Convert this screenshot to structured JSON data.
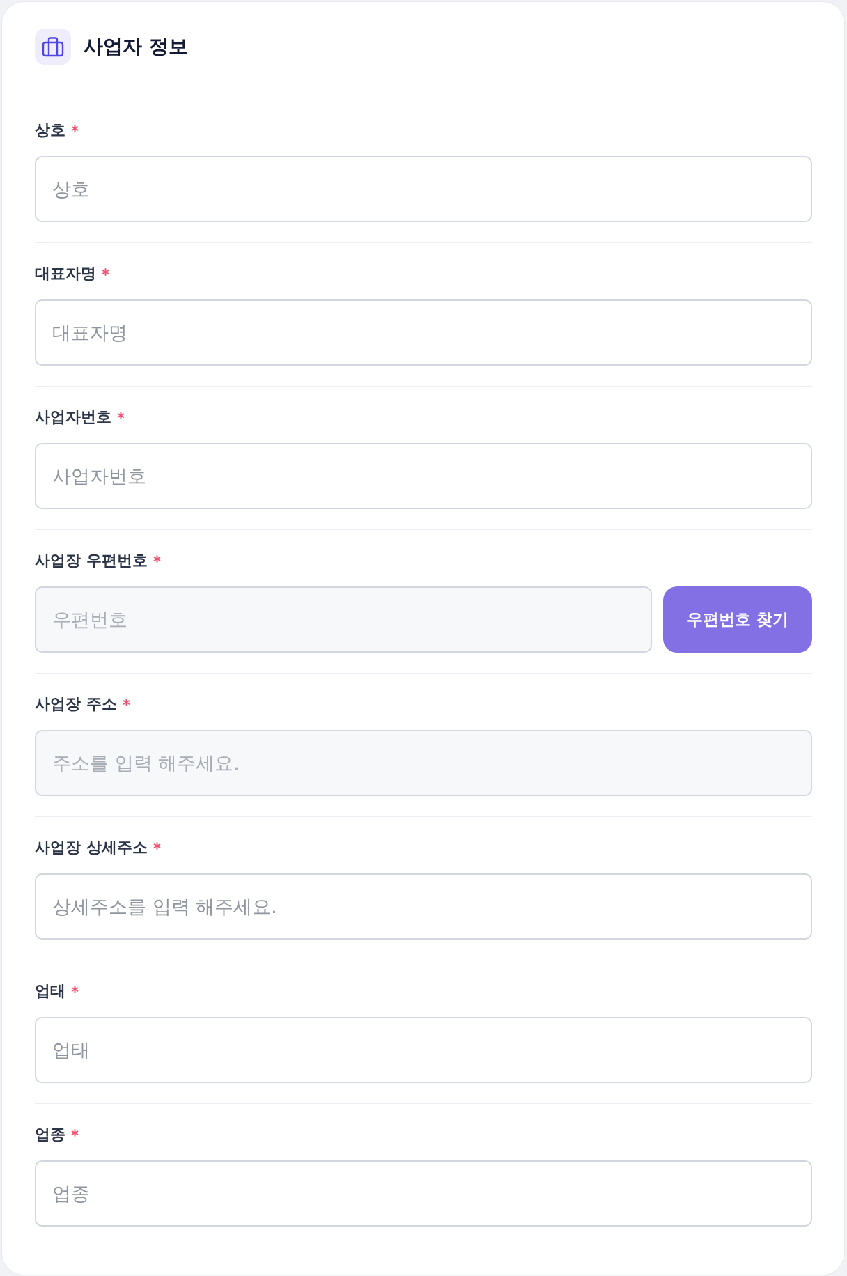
{
  "header": {
    "title": "사업자 정보"
  },
  "fields": [
    {
      "kind": "input",
      "label": "상호",
      "required": true,
      "placeholder": "상호",
      "readonly": false
    },
    {
      "kind": "input",
      "label": "대표자명",
      "required": true,
      "placeholder": "대표자명",
      "readonly": false
    },
    {
      "kind": "input",
      "label": "사업자번호",
      "required": true,
      "placeholder": "사업자번호",
      "readonly": false
    },
    {
      "kind": "input_with_button",
      "label": "사업장 우편번호",
      "required": true,
      "placeholder": "우편번호",
      "readonly": true,
      "button": "우편번호 찾기"
    },
    {
      "kind": "input",
      "label": "사업장 주소",
      "required": true,
      "placeholder": "주소를 입력 해주세요.",
      "readonly": true
    },
    {
      "kind": "input",
      "label": "사업장 상세주소",
      "required": true,
      "placeholder": "상세주소를 입력 해주세요.",
      "readonly": false
    },
    {
      "kind": "input",
      "label": "업태",
      "required": true,
      "placeholder": "업태",
      "readonly": false
    },
    {
      "kind": "input",
      "label": "업종",
      "required": true,
      "placeholder": "업종",
      "readonly": false
    }
  ]
}
